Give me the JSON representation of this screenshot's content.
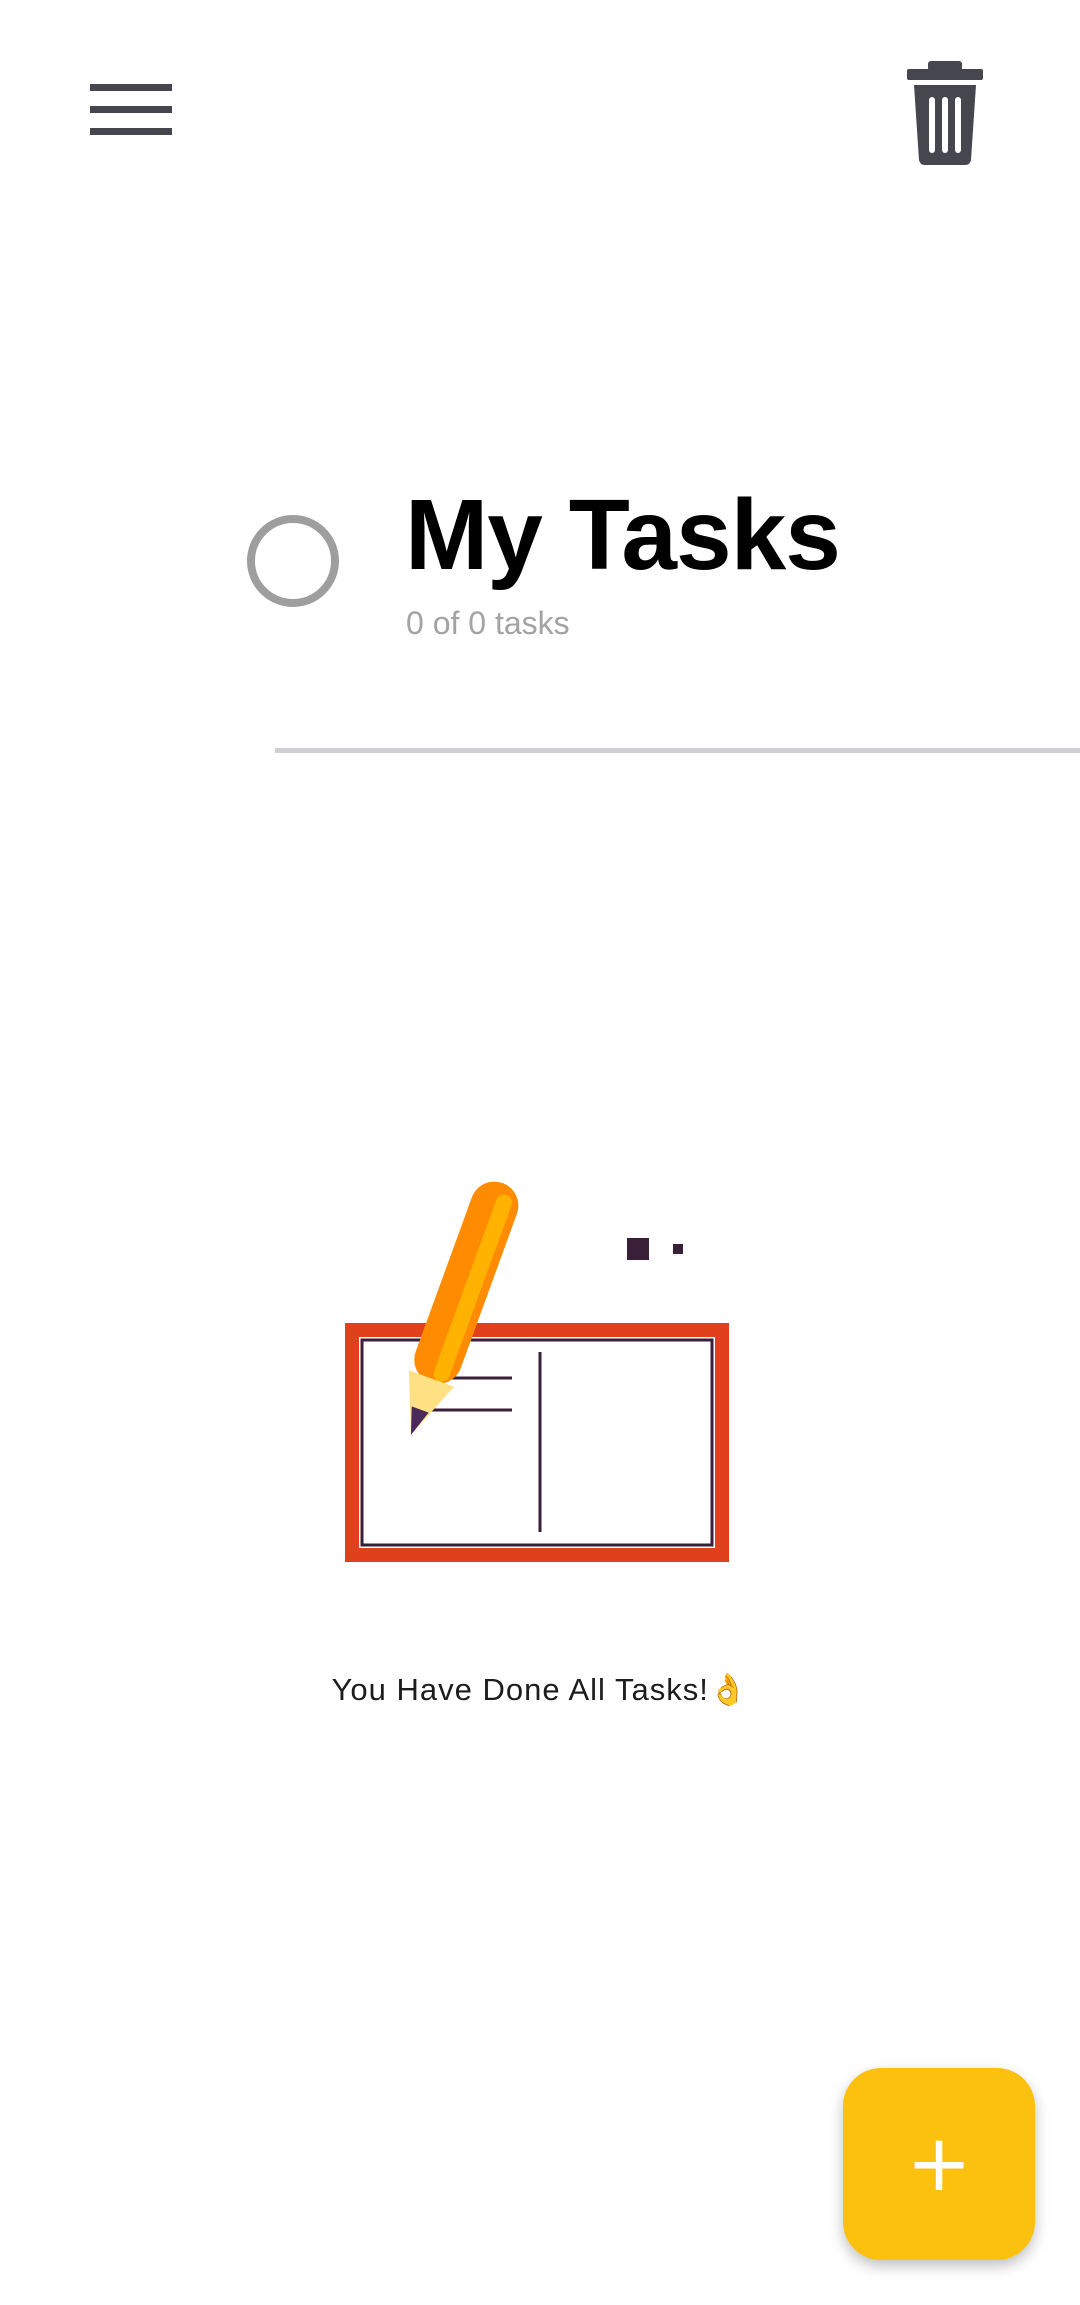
{
  "app": {
    "accent_color": "#fcc10f"
  },
  "toolbar": {
    "menu_icon": "hamburger-menu-icon",
    "delete_icon": "trash-icon"
  },
  "header": {
    "title": "My Tasks",
    "progress_text": "0 of 0 tasks",
    "progress": 0,
    "progress_ring_color": "#9e9e9e"
  },
  "empty_state": {
    "illustration": "pencil-and-card-illustration",
    "message": "You Have Done All Tasks!👌"
  },
  "fab": {
    "label": "+",
    "icon": "plus-icon"
  }
}
